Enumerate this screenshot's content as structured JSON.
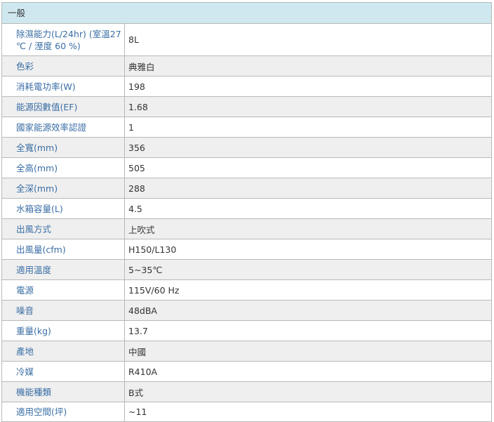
{
  "section_title": "一般",
  "specs": [
    {
      "label": "除濕能力(L/24hr) (室溫27 ℃ / 溼度 60 %)",
      "value": "8L"
    },
    {
      "label": "色彩",
      "value": "典雅白"
    },
    {
      "label": "消耗電功率(W)",
      "value": "198"
    },
    {
      "label": "能源因數值(EF)",
      "value": "1.68"
    },
    {
      "label": "國家能源效率認證",
      "value": "1"
    },
    {
      "label": "全寬(mm)",
      "value": "356"
    },
    {
      "label": "全高(mm)",
      "value": "505"
    },
    {
      "label": "全深(mm)",
      "value": "288"
    },
    {
      "label": "水箱容量(L)",
      "value": "4.5"
    },
    {
      "label": "出風方式",
      "value": "上吹式"
    },
    {
      "label": "出風量(cfm)",
      "value": "H150/L130"
    },
    {
      "label": "適用溫度",
      "value": "5~35℃"
    },
    {
      "label": "電源",
      "value": "115V/60 Hz"
    },
    {
      "label": "噪音",
      "value": "48dBA"
    },
    {
      "label": "重量(kg)",
      "value": "13.7"
    },
    {
      "label": "產地",
      "value": "中國"
    },
    {
      "label": "冷媒",
      "value": "R410A"
    },
    {
      "label": "機能種類",
      "value": "B式"
    },
    {
      "label": "適用空間(坪)",
      "value": "~11"
    }
  ]
}
